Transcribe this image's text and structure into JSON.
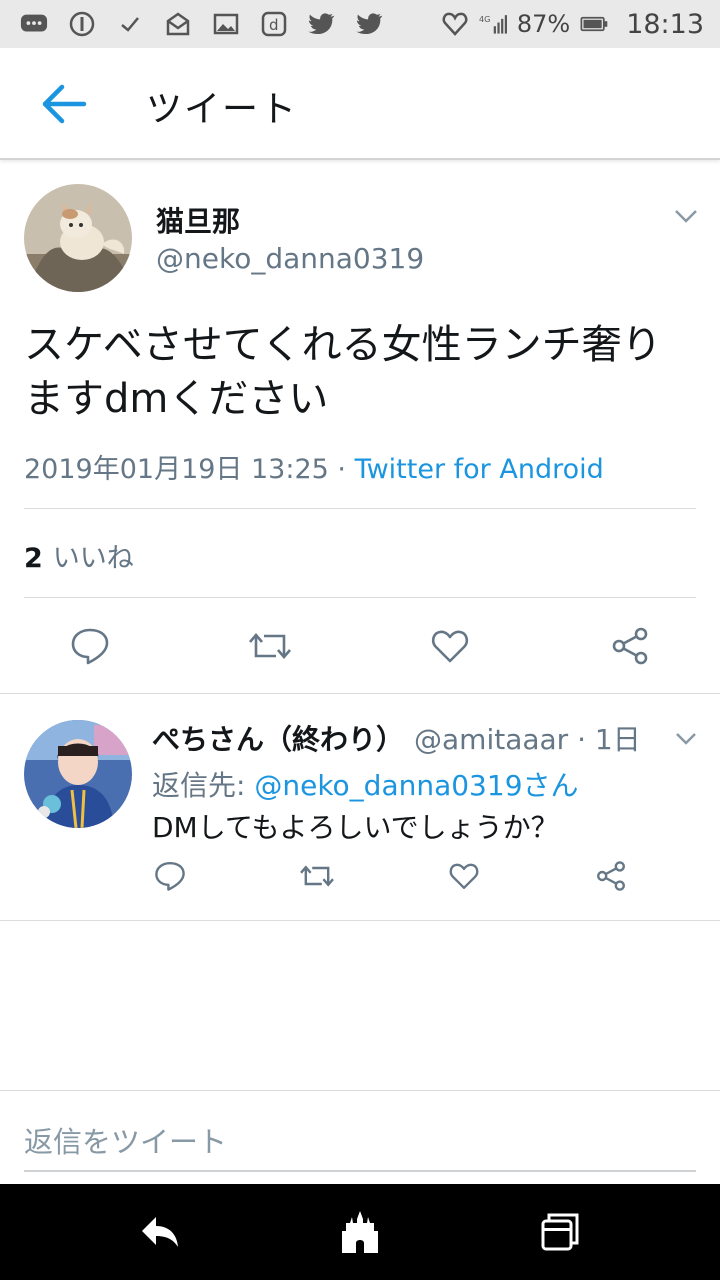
{
  "status_bar": {
    "battery": "87%",
    "network": "4G",
    "time": "18:13",
    "icons_left": [
      "chat-bubble-icon",
      "info-circle-icon",
      "check-icon",
      "mail-icon",
      "image-icon",
      "d-app-icon",
      "twitter-bird-icon",
      "twitter-bird-icon"
    ]
  },
  "app_bar": {
    "title": "ツイート",
    "back_icon": "arrow-left-icon",
    "accent": "#1b95e0"
  },
  "main_tweet": {
    "name": "猫旦那",
    "handle": "@neko_danna0319",
    "text": "スケベさせてくれる女性ランチ奢りますdmください",
    "date": "2019年01月19日 13:25 · ",
    "source": "Twitter for Android",
    "like_count": "2",
    "like_label": "いいね",
    "actions": [
      "reply-icon",
      "retweet-icon",
      "like-icon",
      "share-icon"
    ]
  },
  "reply_tweet": {
    "name": "ぺちさん（終わり）",
    "handle": "@amitaaar · 1日",
    "reply_to_label": "返信先: ",
    "reply_to_mention": "@neko_danna0319さん",
    "text": "DMしてもよろしいでしょうか？"
  },
  "compose": {
    "placeholder": "返信をツイート"
  },
  "nav_bar": {
    "icons": [
      "back-nav-icon",
      "castle-home-icon",
      "recent-apps-icon"
    ]
  },
  "colors": {
    "text_primary": "#14171a",
    "text_secondary": "#657786",
    "link": "#1b95e0",
    "status_bar_bg": "#e9e9e9"
  }
}
